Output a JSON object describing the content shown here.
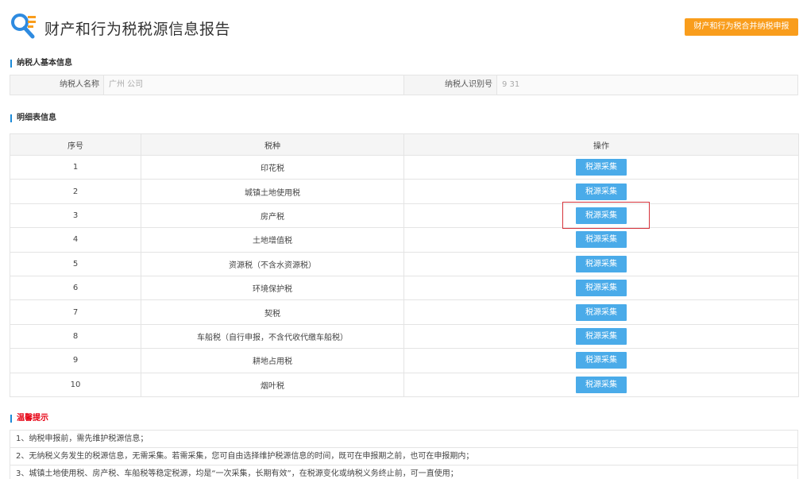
{
  "header": {
    "title": "财产和行为税税源信息报告",
    "action_button": "财产和行为税合并纳税申报"
  },
  "taxpayer_section": {
    "title": "纳税人基本信息",
    "name_label": "纳税人名称",
    "name_value": "广州                        公司",
    "id_label": "纳税人识别号",
    "id_value": "9                              31"
  },
  "detail_section": {
    "title": "明细表信息",
    "columns": [
      "序号",
      "税种",
      "操作"
    ],
    "rows": [
      {
        "no": "1",
        "tax": "印花税",
        "action": "税源采集"
      },
      {
        "no": "2",
        "tax": "城镇土地使用税",
        "action": "税源采集"
      },
      {
        "no": "3",
        "tax": "房产税",
        "action": "税源采集"
      },
      {
        "no": "4",
        "tax": "土地增值税",
        "action": "税源采集"
      },
      {
        "no": "5",
        "tax": "资源税（不含水资源税）",
        "action": "税源采集"
      },
      {
        "no": "6",
        "tax": "环境保护税",
        "action": "税源采集"
      },
      {
        "no": "7",
        "tax": "契税",
        "action": "税源采集"
      },
      {
        "no": "8",
        "tax": "车船税（自行申报，不含代收代缴车船税）",
        "action": "税源采集"
      },
      {
        "no": "9",
        "tax": "耕地占用税",
        "action": "税源采集"
      },
      {
        "no": "10",
        "tax": "烟叶税",
        "action": "税源采集"
      }
    ]
  },
  "tips_section": {
    "title": "温馨提示",
    "items": [
      "1、纳税申报前，需先维护税源信息；",
      "2、无纳税义务发生的税源信息，无需采集。若需采集，您可自由选择维护税源信息的时间，既可在申报期之前，也可在申报期内；",
      "3、城镇土地使用税、房产税、车船税等稳定税源，均是“一次采集，长期有效”，在税源变化或纳税义务终止前，可一直使用；"
    ]
  },
  "colors": {
    "accent_orange": "#f99d1c",
    "button_blue": "#4aabe9",
    "section_bar_blue": "#1d8bd8",
    "warning_red": "#e60012",
    "highlight_red": "#d6323a"
  }
}
